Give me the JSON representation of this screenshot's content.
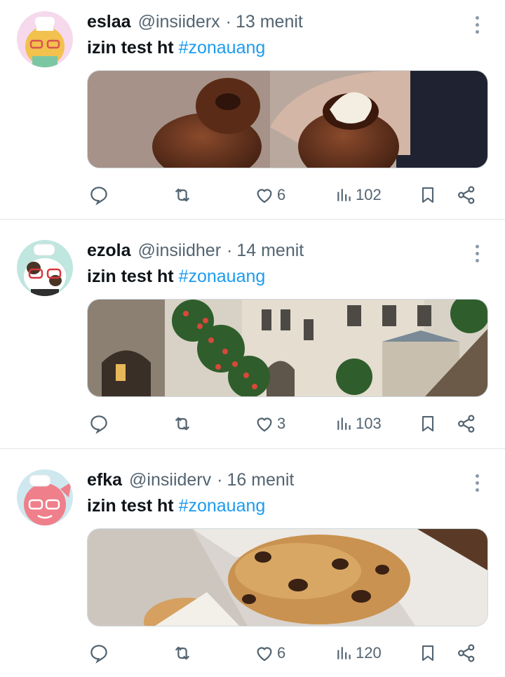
{
  "tweets": [
    {
      "name": "eslaa",
      "handle": "@insiiderx",
      "time": "13 menit",
      "text": "izin test ht",
      "hashtag": "#zonauang",
      "likes": "6",
      "views": "102",
      "media_icon": "chocolate-dessert-photo"
    },
    {
      "name": "ezola",
      "handle": "@insiidher",
      "time": "14 menit",
      "text": "izin test ht",
      "hashtag": "#zonauang",
      "likes": "3",
      "views": "103",
      "media_icon": "building-flowers-photo"
    },
    {
      "name": "efka",
      "handle": "@insiiderv",
      "time": "16 menit",
      "text": "izin test ht",
      "hashtag": "#zonauang",
      "likes": "6",
      "views": "120",
      "media_icon": "cookies-box-photo"
    }
  ],
  "separator": "·",
  "colors": {
    "accent": "#1d9bf0",
    "secondary_text": "#536471",
    "divider": "#e1e5e8"
  }
}
